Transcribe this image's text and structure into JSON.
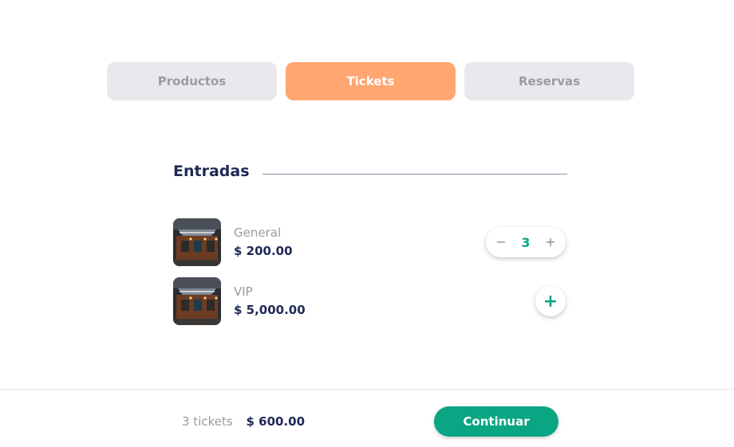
{
  "tabs": [
    {
      "label": "Productos"
    },
    {
      "label": "Tickets"
    },
    {
      "label": "Reservas"
    }
  ],
  "section": {
    "title": "Entradas"
  },
  "items": [
    {
      "name": "General",
      "price": "$ 200.00",
      "quantity": "3",
      "minus_icon": "−",
      "plus_icon": "+"
    },
    {
      "name": "VIP",
      "price": "$ 5,000.00",
      "add_icon": "+"
    }
  ],
  "footer": {
    "count": "3 tickets",
    "total": "$ 600.00",
    "continue_label": "Continuar"
  },
  "colors": {
    "accent": "#ffa671",
    "primary": "#0aa583",
    "navy": "#1f2a56"
  }
}
